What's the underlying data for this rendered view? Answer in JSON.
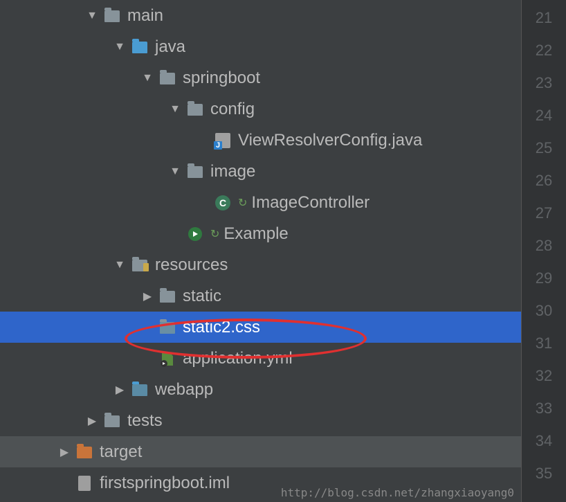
{
  "tree": {
    "main": "main",
    "java": "java",
    "springboot": "springboot",
    "config": "config",
    "viewResolverConfig": "ViewResolverConfig.java",
    "image": "image",
    "imageController": "ImageController",
    "example": "Example",
    "resources": "resources",
    "static": "static",
    "static2css": "static2.css",
    "applicationYml": "application.yml",
    "webapp": "webapp",
    "tests": "tests",
    "target": "target",
    "firstspringbootIml": "firstspringboot.iml"
  },
  "lineNumbers": [
    "21",
    "22",
    "23",
    "24",
    "25",
    "26",
    "27",
    "28",
    "29",
    "30",
    "31",
    "32",
    "33",
    "34",
    "35"
  ],
  "watermark": "http://blog.csdn.net/zhangxiaoyang0"
}
